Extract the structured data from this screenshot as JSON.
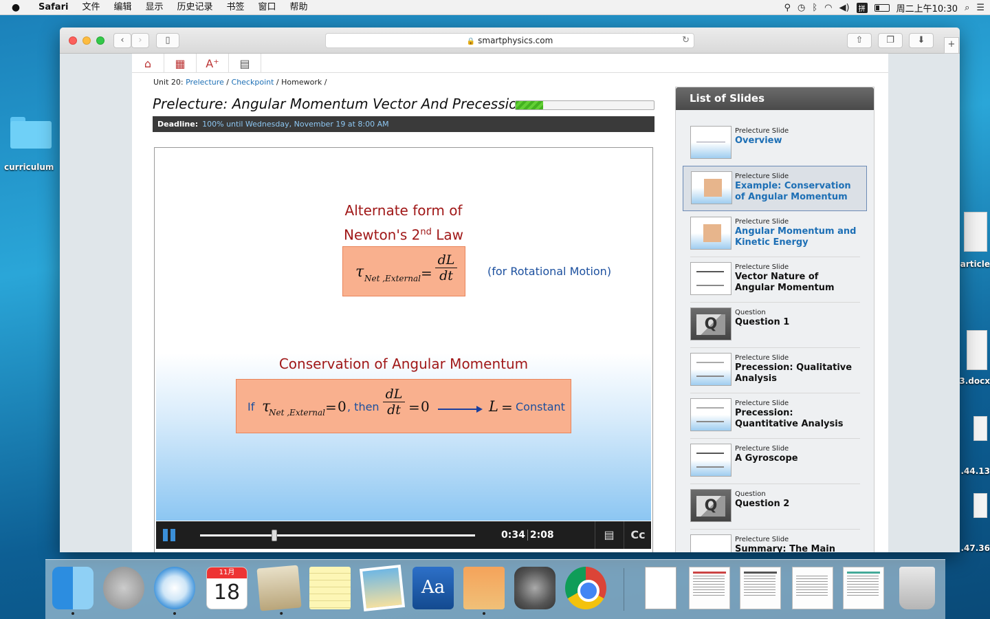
{
  "menubar": {
    "app": "Safari",
    "menus": [
      "文件",
      "编辑",
      "显示",
      "历史记录",
      "书签",
      "窗口",
      "帮助"
    ],
    "clock": "周二上午10:30",
    "input_method": "拼"
  },
  "desktop": {
    "folder_label": "curriculum",
    "right_labels": [
      "article",
      "3.docx",
      ".44.13",
      ".47.36"
    ]
  },
  "browser": {
    "url": "smartphysics.com"
  },
  "course": {
    "breadcrumb": {
      "unit": "Unit 20:",
      "prelecture": "Prelecture",
      "checkpoint": "Checkpoint",
      "homework": "Homework",
      "sep": "/"
    },
    "title": "Prelecture: Angular Momentum Vector And Precession",
    "progress": 0.2,
    "deadline_label": "Deadline:",
    "deadline_value": "100% until Wednesday, November 19 at 8:00 AM"
  },
  "slide": {
    "heading1_line1": "Alternate form of",
    "heading1_line2_pre": "Newton's 2",
    "heading1_sup": "nd",
    "heading1_line2_post": " Law",
    "torque_symbol": "τ",
    "torque_subscript": "Net ,External",
    "eq": "=",
    "dL": "dL",
    "dt": "dt",
    "rotational_note": "(for Rotational Motion)",
    "heading2": "Conservation of Angular Momentum",
    "if": "If",
    "zero": "0",
    "then": ", then",
    "L": "L",
    "constant": "Constant"
  },
  "player": {
    "elapsed": "0:34",
    "duration": "2:08",
    "played_fraction": 0.27
  },
  "slide_list": {
    "header": "List of Slides",
    "items": [
      {
        "kind": "Prelecture Slide",
        "title": "Overview"
      },
      {
        "kind": "Prelecture Slide",
        "title": "Example: Conservation of Angular Momentum"
      },
      {
        "kind": "Prelecture Slide",
        "title": "Angular Momentum and Kinetic Energy"
      },
      {
        "kind": "Prelecture Slide",
        "title": "Vector Nature of Angular Momentum"
      },
      {
        "kind": "Question",
        "title": "Question 1"
      },
      {
        "kind": "Prelecture Slide",
        "title": "Precession: Qualitative Analysis"
      },
      {
        "kind": "Prelecture Slide",
        "title": "Precession: Quantitative Analysis"
      },
      {
        "kind": "Prelecture Slide",
        "title": "A Gyroscope"
      },
      {
        "kind": "Question",
        "title": "Question 2"
      },
      {
        "kind": "Prelecture Slide",
        "title": "Summary: The Main Ideas"
      }
    ]
  },
  "dock": {
    "calendar_month": "11月",
    "calendar_day": "18",
    "dictionary_glyph": "Aa"
  }
}
